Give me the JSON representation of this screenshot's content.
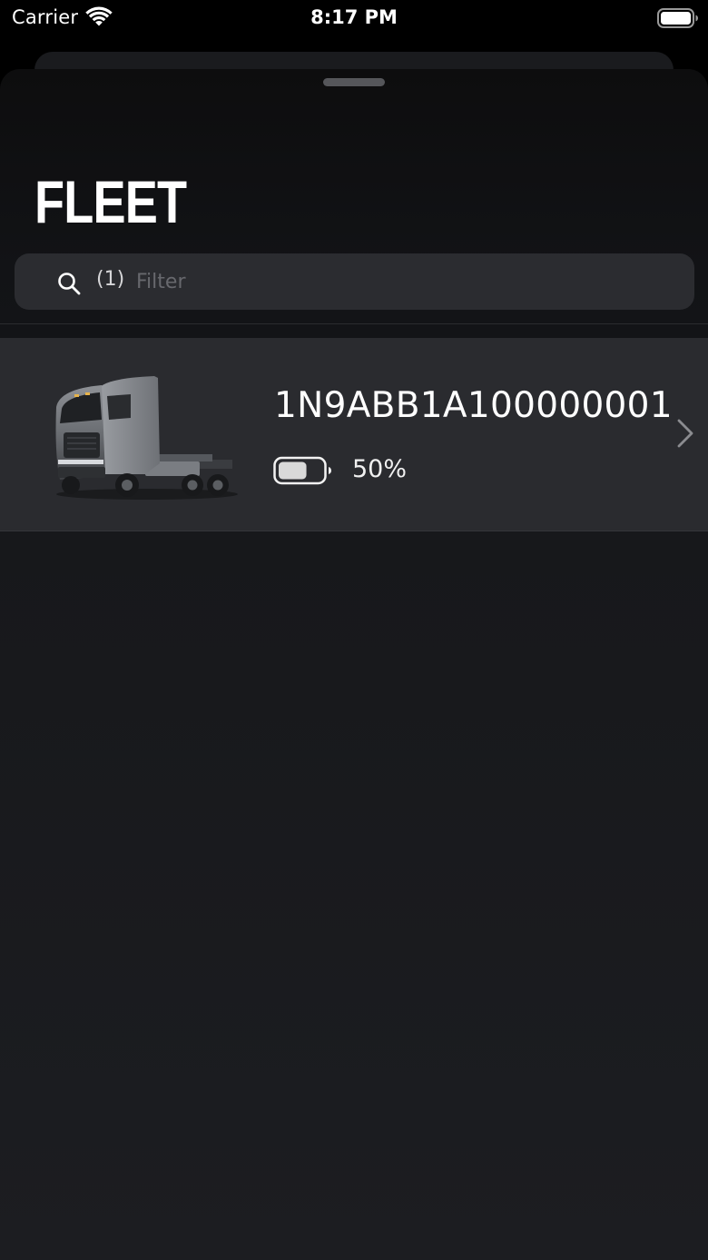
{
  "status_bar": {
    "carrier": "Carrier",
    "time": "8:17 PM",
    "icons": [
      "wifi-icon",
      "battery-icon"
    ]
  },
  "header": {
    "title": "FLEET"
  },
  "search": {
    "count": "(1)",
    "placeholder": "Filter",
    "value": "",
    "icon": "search-icon"
  },
  "vehicles": [
    {
      "vin": "1N9ABB1A100000001",
      "battery_percent_label": "50%",
      "battery_level": 0.5,
      "image": "truck-image",
      "chevron": "chevron-right-icon"
    }
  ],
  "colors": {
    "background": "#000000",
    "sheet": "#121316",
    "row": "#2a2b2f",
    "search_field": "#2b2c30",
    "placeholder": "#67686d",
    "text": "#ffffff"
  }
}
